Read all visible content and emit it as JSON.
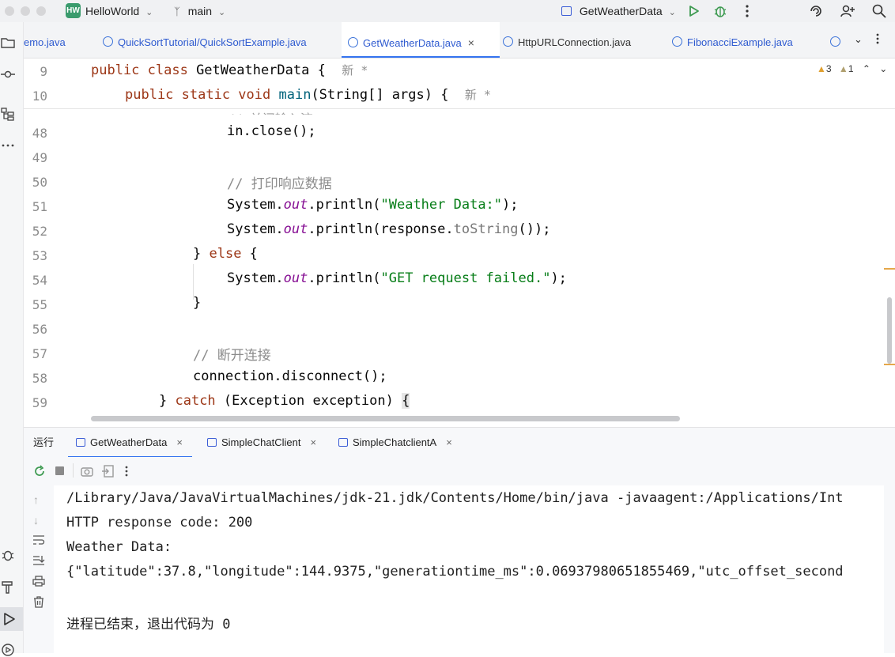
{
  "titlebar": {
    "project_badge": "HW",
    "project_name": "HelloWorld",
    "branch": "main",
    "run_config": "GetWeatherData"
  },
  "tabs": [
    {
      "label": "emo.java"
    },
    {
      "label": "QuickSortTutorial/QuickSortExample.java"
    },
    {
      "label": "GetWeatherData.java"
    },
    {
      "label": "HttpURLConnection.java"
    },
    {
      "label": "FibonacciExample.java"
    }
  ],
  "editor": {
    "warnings": "3",
    "weak_warnings": "1",
    "sticky": [
      {
        "line": "9",
        "text": "public class GetWeatherData {",
        "hint": "新 *"
      },
      {
        "line": "10",
        "text": "public static void main(String[] args) {",
        "hint": "新 *"
      }
    ],
    "lines": [
      {
        "n": "48",
        "code": "in.close();"
      },
      {
        "n": "49",
        "code": ""
      },
      {
        "n": "50",
        "code": "// 打印响应数据"
      },
      {
        "n": "51",
        "code": "System.out.println(\"Weather Data:\");"
      },
      {
        "n": "52",
        "code": "System.out.println(response.toString());"
      },
      {
        "n": "53",
        "code": "} else {"
      },
      {
        "n": "54",
        "code": "System.out.println(\"GET request failed.\");"
      },
      {
        "n": "55",
        "code": "}"
      },
      {
        "n": "56",
        "code": ""
      },
      {
        "n": "57",
        "code": "// 断开连接"
      },
      {
        "n": "58",
        "code": "connection.disconnect();"
      },
      {
        "n": "59",
        "code": "} catch (Exception exception) {"
      }
    ],
    "partial_comment": "// 关闭输入流"
  },
  "run": {
    "panel_label": "运行",
    "tabs": [
      {
        "label": "GetWeatherData"
      },
      {
        "label": "SimpleChatClient"
      },
      {
        "label": "SimpleChatclientA"
      }
    ]
  },
  "console": {
    "lines": [
      "/Library/Java/JavaVirtualMachines/jdk-21.jdk/Contents/Home/bin/java -javaagent:/Applications/Int",
      "HTTP response code: 200",
      "Weather Data:",
      "{\"latitude\":37.8,\"longitude\":144.9375,\"generationtime_ms\":0.06937980651855469,\"utc_offset_second",
      "",
      "进程已结束，退出代码为 0"
    ]
  },
  "colors": {
    "accent": "#3574f0",
    "keyword": "#0033b3",
    "string": "#067d17",
    "field": "#871094",
    "comment": "#8c8c8c"
  }
}
